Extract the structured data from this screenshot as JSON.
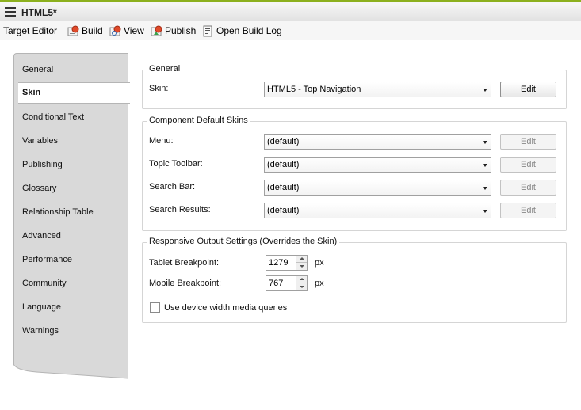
{
  "window": {
    "title": "HTML5*",
    "accent_color": "#8cb01e"
  },
  "toolbar": {
    "target_editor": "Target Editor",
    "build": "Build",
    "view": "View",
    "publish": "Publish",
    "open_build_log": "Open Build Log"
  },
  "tabs": [
    {
      "label": "General"
    },
    {
      "label": "Skin",
      "active": true
    },
    {
      "label": "Conditional Text"
    },
    {
      "label": "Variables"
    },
    {
      "label": "Publishing"
    },
    {
      "label": "Glossary"
    },
    {
      "label": "Relationship Table"
    },
    {
      "label": "Advanced"
    },
    {
      "label": "Performance"
    },
    {
      "label": "Community"
    },
    {
      "label": "Language"
    },
    {
      "label": "Warnings"
    }
  ],
  "general_group": {
    "legend": "General",
    "skin_label": "Skin:",
    "skin_value": "HTML5 - Top Navigation",
    "edit_label": "Edit"
  },
  "component_group": {
    "legend": "Component Default Skins",
    "rows": [
      {
        "label": "Menu:",
        "value": "(default)",
        "edit": "Edit"
      },
      {
        "label": "Topic Toolbar:",
        "value": "(default)",
        "edit": "Edit"
      },
      {
        "label": "Search Bar:",
        "value": "(default)",
        "edit": "Edit"
      },
      {
        "label": "Search Results:",
        "value": "(default)",
        "edit": "Edit"
      }
    ]
  },
  "responsive_group": {
    "legend": "Responsive Output Settings (Overrides the Skin)",
    "tablet_label": "Tablet Breakpoint:",
    "tablet_value": "1279",
    "mobile_label": "Mobile Breakpoint:",
    "mobile_value": "767",
    "unit": "px",
    "checkbox_label": "Use device width media queries",
    "checkbox_checked": false
  }
}
